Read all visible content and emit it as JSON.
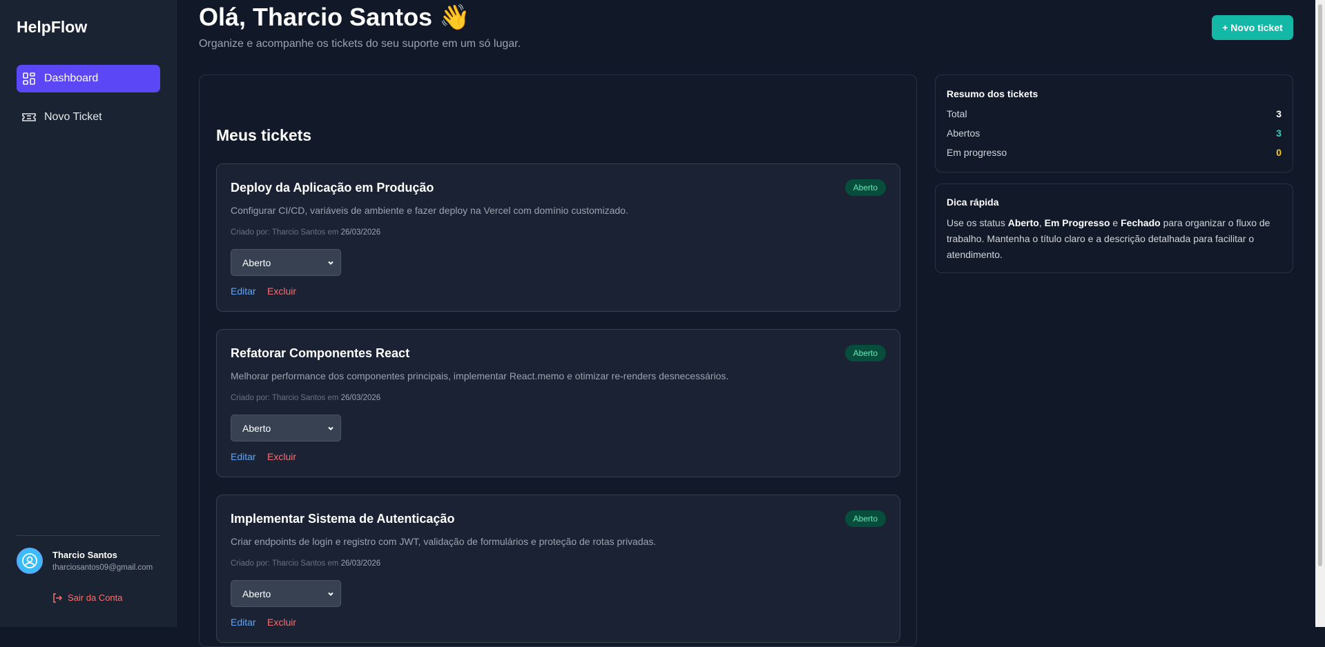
{
  "sidebar": {
    "brand": "HelpFlow",
    "nav": [
      {
        "label": "Dashboard",
        "icon": "dashboard-grid-icon",
        "active": true
      },
      {
        "label": "Novo Ticket",
        "icon": "ticket-icon",
        "active": false
      }
    ],
    "user": {
      "name": "Tharcio Santos",
      "email": "tharciosantos09@gmail.com",
      "avatar_icon": "user-avatar-icon"
    },
    "logout_label": "Sair da Conta"
  },
  "header": {
    "greeting": "Olá, Tharcio Santos 👋",
    "subtitle": "Organize e acompanhe os tickets do seu suporte em um só lugar.",
    "new_ticket_label": "+ Novo ticket"
  },
  "main": {
    "title": "Meus tickets",
    "tickets": [
      {
        "title": "Deploy da Aplicação em Produção",
        "status_badge": "Aberto",
        "description": "Configurar CI/CD, variáveis de ambiente e fazer deploy na Vercel com domínio customizado.",
        "created_prefix": "Criado por: Tharcio Santos em",
        "created_date": "26/03/2026",
        "select_value": "Aberto",
        "edit_label": "Editar",
        "delete_label": "Excluir"
      },
      {
        "title": "Refatorar Componentes React",
        "status_badge": "Aberto",
        "description": "Melhorar performance dos componentes principais, implementar React.memo e otimizar re-renders desnecessários.",
        "created_prefix": "Criado por: Tharcio Santos em",
        "created_date": "26/03/2026",
        "select_value": "Aberto",
        "edit_label": "Editar",
        "delete_label": "Excluir"
      },
      {
        "title": "Implementar Sistema de Autenticação",
        "status_badge": "Aberto",
        "description": "Criar endpoints de login e registro com JWT, validação de formulários e proteção de rotas privadas.",
        "created_prefix": "Criado por: Tharcio Santos em",
        "created_date": "26/03/2026",
        "select_value": "Aberto",
        "edit_label": "Editar",
        "delete_label": "Excluir"
      }
    ]
  },
  "summary": {
    "title": "Resumo dos tickets",
    "rows": [
      {
        "label": "Total",
        "value": "3",
        "color": "#ffffff"
      },
      {
        "label": "Abertos",
        "value": "3",
        "color": "#2dd4bf"
      },
      {
        "label": "Em progresso",
        "value": "0",
        "color": "#facc15"
      }
    ]
  },
  "tip": {
    "title": "Dica rápida",
    "text_1": "Use os status ",
    "bold_1": "Aberto",
    "text_2": ", ",
    "bold_2": "Em Progresso",
    "text_3": " e ",
    "bold_3": "Fechado",
    "text_4": " para organizar o fluxo de trabalho. Mantenha o título claro e a descrição detalhada para facilitar o atendimento."
  },
  "colors": {
    "accent": "#5b47f5",
    "primary_button": "#14b8a6",
    "badge_bg": "#064e3b",
    "badge_text": "#6ee7b7",
    "link_edit": "#60a5fa",
    "link_delete": "#f87171"
  }
}
